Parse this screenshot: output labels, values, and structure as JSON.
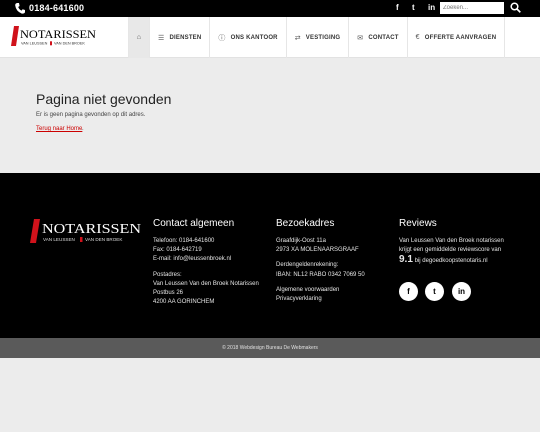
{
  "topbar": {
    "phone": "0184-641600",
    "social": [
      "f",
      "t",
      "in"
    ],
    "search_placeholder": "Zoeken..."
  },
  "logo": {
    "name": "NOTARISSEN",
    "sub_left": "VAN LEUSSEN",
    "sub_right": "VAN DEN BROEK"
  },
  "nav": {
    "items": [
      {
        "label": "",
        "icon": "home-icon"
      },
      {
        "label": "DIENSTEN",
        "icon": "list-icon"
      },
      {
        "label": "ONS KANTOOR",
        "icon": "info-icon"
      },
      {
        "label": "VESTIGING",
        "icon": "signpost-icon"
      },
      {
        "label": "CONTACT",
        "icon": "envelope-icon"
      },
      {
        "label": "OFFERTE AANVRAGEN",
        "icon": "euro-icon"
      }
    ]
  },
  "main": {
    "title": "Pagina niet gevonden",
    "message": "Er is geen pagina gevonden op dit adres.",
    "back_link": "Terug naar Home",
    "back_suffix": "."
  },
  "footer": {
    "contact": {
      "title": "Contact algemeen",
      "phone": "Telefoon: 0184-641600",
      "fax": "Fax: 0184-642719",
      "email": "E-mail: info@leussenbroek.nl",
      "postal_title": "Postadres:",
      "postal_name": "Van Leussen Van den Broek Notarissen",
      "postal_box": "Postbus 26",
      "postal_city": "4200 AA GORINCHEM"
    },
    "visit": {
      "title": "Bezoekadres",
      "street": "Graafdijk-Oost 11a",
      "city": "2973 XA MOLENAARSGRAAF",
      "third_party_title": "Derdengeldenrekening:",
      "iban": "IBAN: NL12 RABO 0342 7069 50",
      "terms": "Algemene voorwaarden",
      "privacy": "Privacyverklaring"
    },
    "reviews": {
      "title": "Reviews",
      "line1": "Van Leussen Van den Broek notarissen",
      "line2": "krijgt een gemiddelde reviewscore van",
      "score": "9.1",
      "source": "bij degoedkoopstenotaris.nl",
      "social": [
        "f",
        "t",
        "in"
      ]
    }
  },
  "copyright": "© 2018 Webdesign Bureau De Webmakers",
  "colors": {
    "brand_red": "#d0121b",
    "topbar": "#000000",
    "footer": "#000000",
    "bottombar": "#5a5a5a"
  }
}
